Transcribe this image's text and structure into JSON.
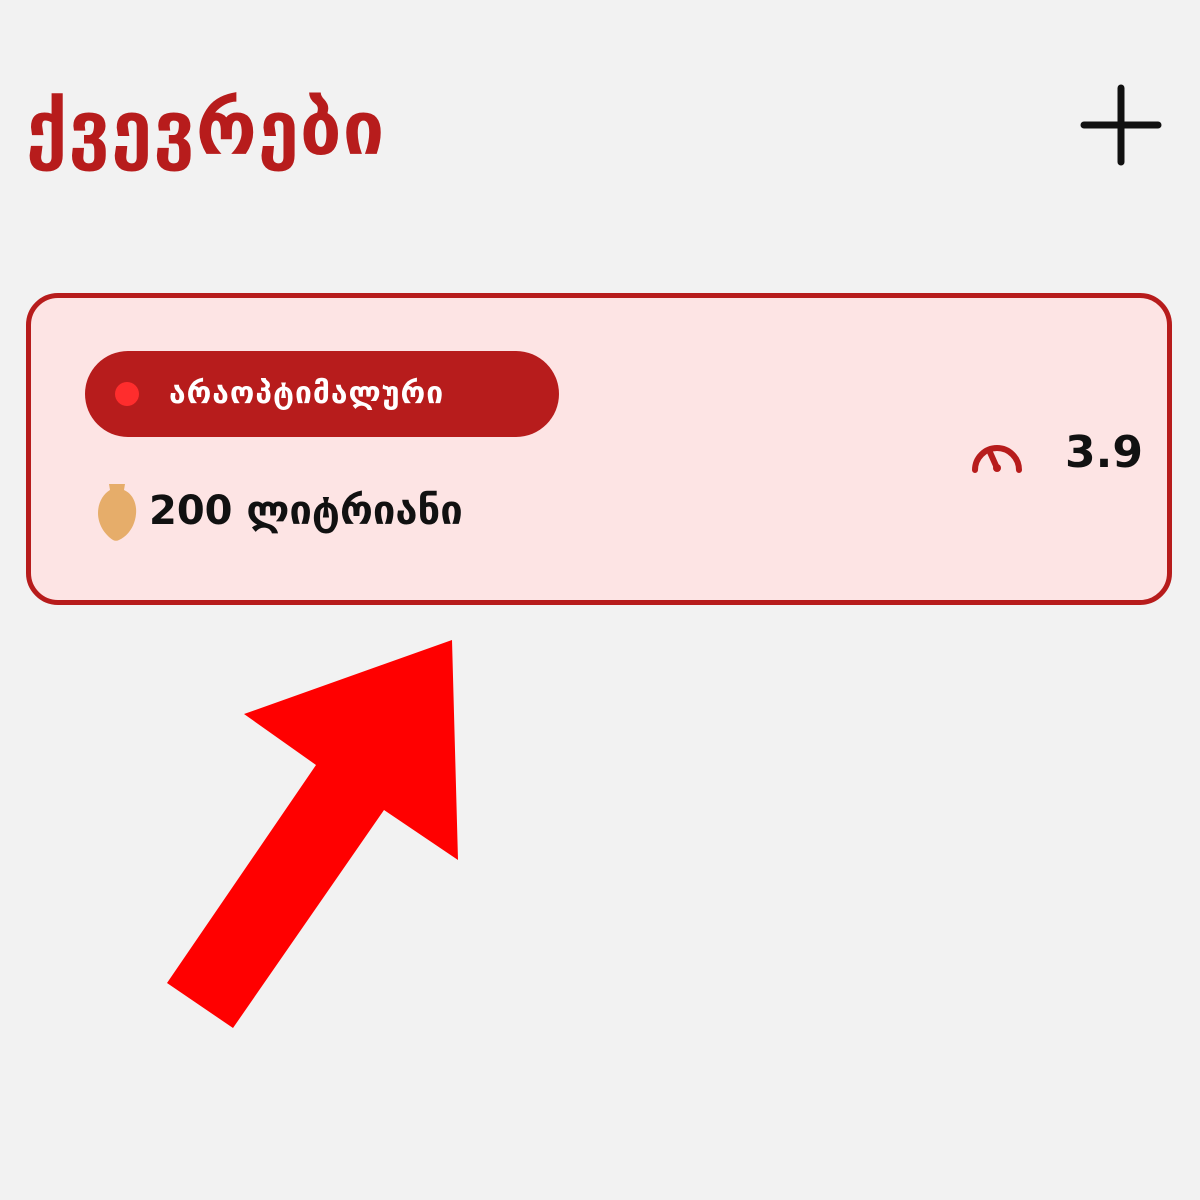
{
  "header": {
    "title": "ქვევრები",
    "add_icon": "plus-icon"
  },
  "qvevri_card": {
    "status": {
      "label": "არაოპტიმალური",
      "dot_color": "#ff2d2d",
      "badge_color": "#b71c1c"
    },
    "volume": {
      "icon": "jar-icon",
      "label": "200 ლიტრიანი"
    },
    "metric": {
      "icon": "gauge-icon",
      "value": "3.9"
    }
  },
  "colors": {
    "accent": "#b71c1c",
    "card_background": "#fde4e4",
    "page_background": "#f2f2f2",
    "annotation_arrow": "#ff0000",
    "jar": "#e6ad6a"
  }
}
